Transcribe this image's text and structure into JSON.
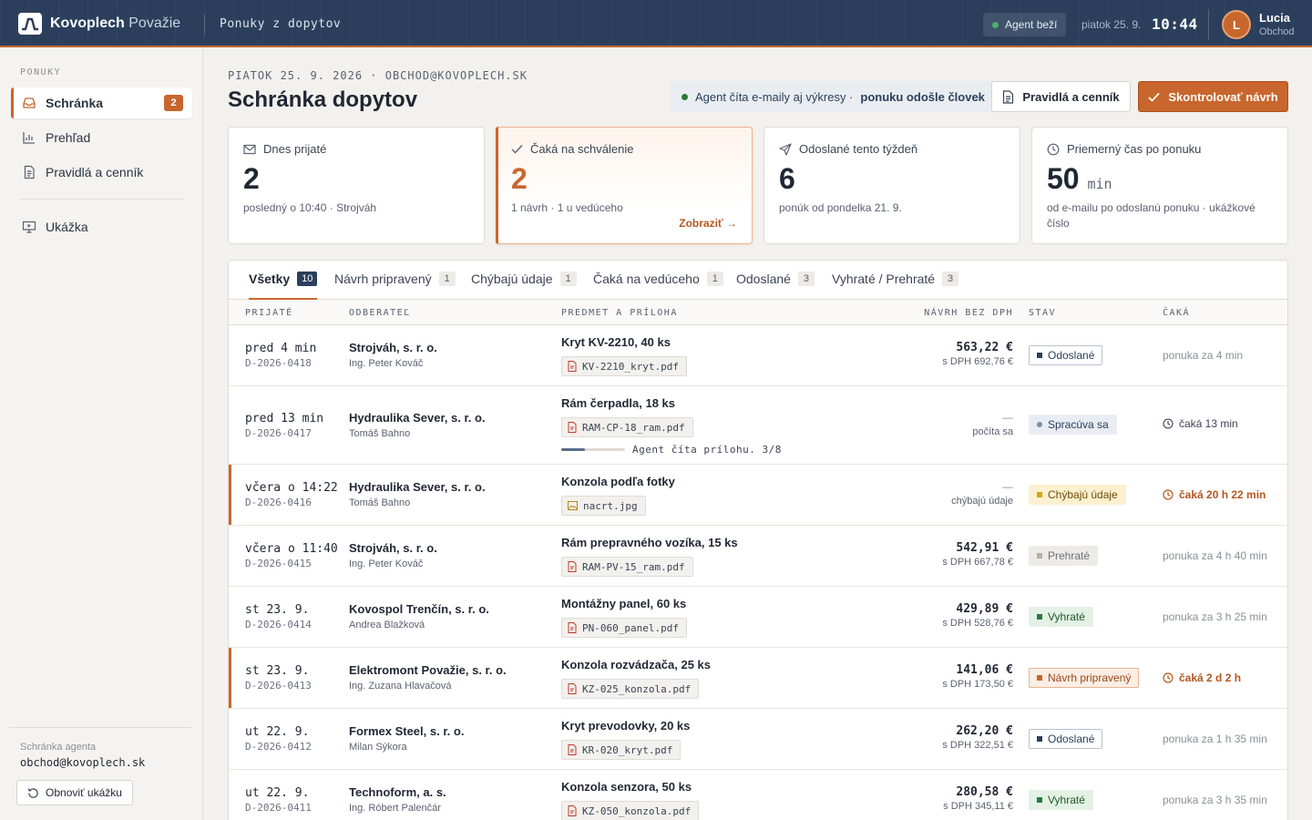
{
  "brand": {
    "name": "Kovoplech",
    "sub": "Považie"
  },
  "top": {
    "section": "Ponuky z dopytov",
    "agent_status": "Agent beží",
    "agent_color": "#4caf6a",
    "date": "piatok 25. 9.",
    "time": "10:44",
    "user_initial": "L",
    "user_name": "Lucia",
    "user_role": "Obchod"
  },
  "sidebar": {
    "section_label": "PONUKY",
    "items": [
      {
        "label": "Schránka",
        "badge": "2",
        "icon": "inbox-icon"
      },
      {
        "label": "Prehľad",
        "icon": "chart-icon"
      },
      {
        "label": "Pravidlá a cenník",
        "icon": "document-icon"
      },
      {
        "label": "Ukážka",
        "icon": "monitor-play-icon"
      }
    ],
    "footer_label": "Schránka agenta",
    "footer_mail": "obchod@kovoplech.sk",
    "reset_label": "Obnoviť ukážku"
  },
  "header": {
    "crumb": "PIATOK 25. 9. 2026 · OBCHOD@KOVOPLECH.SK",
    "title": "Schránka dopytov",
    "notice_a": "Agent číta e-maily aj výkresy ·",
    "notice_b": "ponuku odošle človek",
    "rules_btn": "Pravidlá a cenník",
    "check_btn": "Skontrolovať návrh"
  },
  "stats": [
    {
      "head": "Dnes prijaté",
      "value": "2",
      "sub": "posledný o 10:40 · Strojváh",
      "icon": "mail-icon"
    },
    {
      "head": "Čaká na schválenie",
      "value": "2",
      "sub": "1 návrh · 1 u vedúceho",
      "link": "Zobraziť",
      "icon": "check-icon"
    },
    {
      "head": "Odoslané tento týždeň",
      "value": "6",
      "sub": "ponúk od pondelka 21. 9.",
      "icon": "send-icon"
    },
    {
      "head": "Priemerný čas po ponuku",
      "value": "50",
      "unit": "min",
      "sub": "od e-mailu po odoslanú ponuku · ukážkové číslo",
      "icon": "clock-icon"
    }
  ],
  "tabs": [
    {
      "label": "Všetky",
      "count": "10"
    },
    {
      "label": "Návrh pripravený",
      "count": "1"
    },
    {
      "label": "Chýbajú údaje",
      "count": "1"
    },
    {
      "label": "Čaká na vedúceho",
      "count": "1"
    },
    {
      "label": "Odoslané",
      "count": "3"
    },
    {
      "label": "Vyhraté / Prehraté",
      "count": "3"
    }
  ],
  "columns": [
    "PRIJATÉ",
    "ODBERATEĽ",
    "PREDMET A PRÍLOHA",
    "NÁVRH BEZ DPH",
    "STAV",
    "ČAKÁ"
  ],
  "rows": [
    {
      "recv": "pred 4 min",
      "id": "D-2026-0418",
      "cust": "Strojváh, s. r. o.",
      "contact": "Ing. Peter Kováč",
      "subj": "Kryt KV-2210, 40 ks",
      "file": "KV-2210_kryt.pdf",
      "price": "563,22 €",
      "vat": "s DPH 692,76 €",
      "status": "Odoslané",
      "wait": "ponuka za 4 min"
    },
    {
      "recv": "pred 13 min",
      "id": "D-2026-0417",
      "cust": "Hydraulika Sever, s. r. o.",
      "contact": "Tomáš Bahno",
      "subj": "Rám čerpadla, 18 ks",
      "file": "RAM-CP-18_ram.pdf",
      "price": "—",
      "vat": "počíta sa",
      "status": "Spracúva sa",
      "wait": "čaká 13 min",
      "progress_text": "Agent číta prílohu. 3/8",
      "progress": 0.375
    },
    {
      "recv": "včera o 14:22",
      "id": "D-2026-0416",
      "cust": "Hydraulika Sever, s. r. o.",
      "contact": "Tomáš Bahno",
      "subj": "Konzola podľa fotky",
      "file": "nacrt.jpg",
      "price": "—",
      "vat": "chýbajú údaje",
      "status": "Chýbajú údaje",
      "wait": "čaká 20 h 22 min"
    },
    {
      "recv": "včera o 11:40",
      "id": "D-2026-0415",
      "cust": "Strojváh, s. r. o.",
      "contact": "Ing. Peter Kováč",
      "subj": "Rám prepravného vozíka, 15 ks",
      "file": "RAM-PV-15_ram.pdf",
      "price": "542,91 €",
      "vat": "s DPH 667,78 €",
      "status": "Prehraté",
      "wait": "ponuka za 4 h 40 min"
    },
    {
      "recv": "st 23. 9.",
      "id": "D-2026-0414",
      "cust": "Kovospol Trenčín, s. r. o.",
      "contact": "Andrea Blažková",
      "subj": "Montážny panel, 60 ks",
      "file": "PN-060_panel.pdf",
      "price": "429,89 €",
      "vat": "s DPH 528,76 €",
      "status": "Vyhraté",
      "wait": "ponuka za 3 h 25 min"
    },
    {
      "recv": "st 23. 9.",
      "id": "D-2026-0413",
      "cust": "Elektromont Považie, s. r. o.",
      "contact": "Ing. Zuzana Hlavačová",
      "subj": "Konzola rozvádzača, 25 ks",
      "file": "KZ-025_konzola.pdf",
      "price": "141,06 €",
      "vat": "s DPH 173,50 €",
      "status": "Návrh pripravený",
      "wait": "čaká 2 d 2 h"
    },
    {
      "recv": "ut 22. 9.",
      "id": "D-2026-0412",
      "cust": "Formex Steel, s. r. o.",
      "contact": "Milan Sýkora",
      "subj": "Kryt prevodovky, 20 ks",
      "file": "KR-020_kryt.pdf",
      "price": "262,20 €",
      "vat": "s DPH 322,51 €",
      "status": "Odoslané",
      "wait": "ponuka za 1 h 35 min"
    },
    {
      "recv": "ut 22. 9.",
      "id": "D-2026-0411",
      "cust": "Technoform, a. s.",
      "contact": "Ing. Róbert Palenčár",
      "subj": "Konzola senzora, 50 ks",
      "file": "KZ-050_konzola.pdf",
      "price": "280,58 €",
      "vat": "s DPH 345,11 €",
      "status": "Vyhraté",
      "wait": "ponuka za 3 h 35 min"
    }
  ],
  "colors": {
    "accent": "#c8662d",
    "navy": "#2b3f5c"
  }
}
